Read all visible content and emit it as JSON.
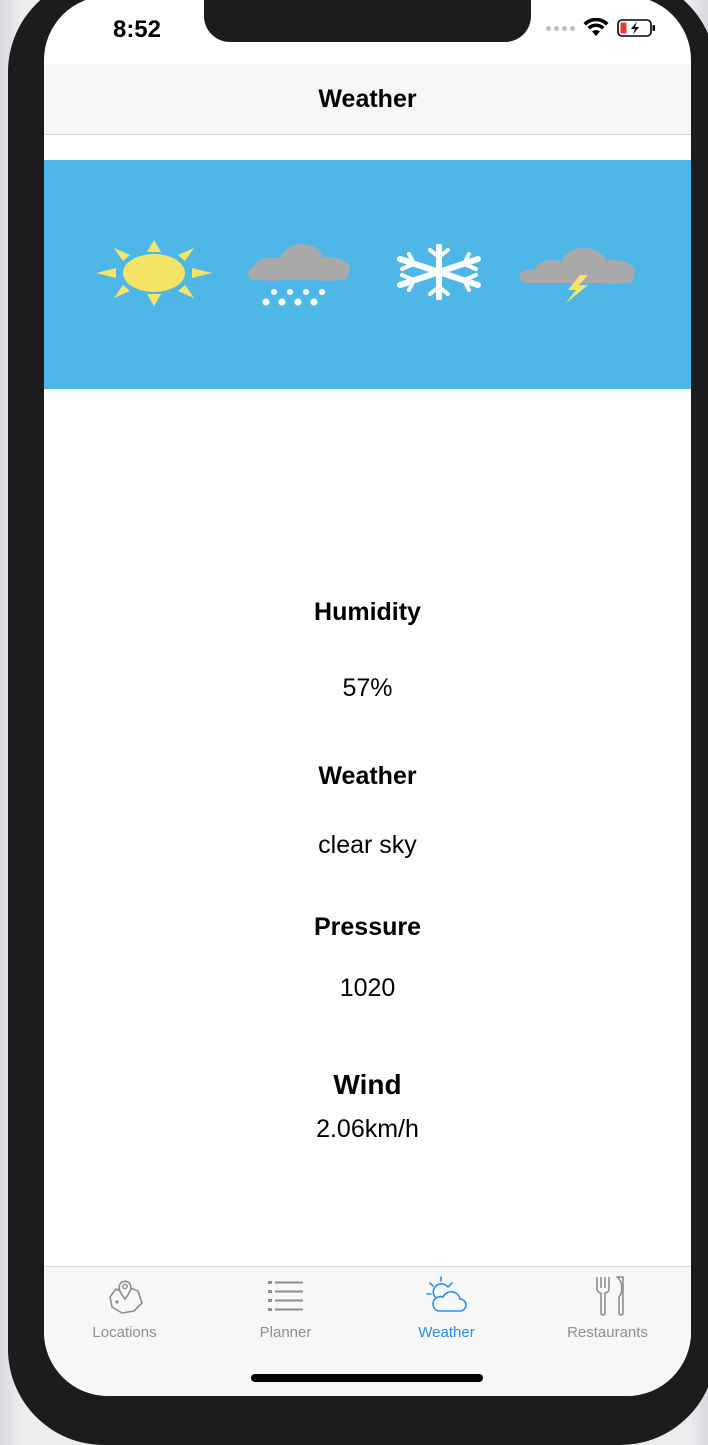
{
  "status_bar": {
    "time": "8:52",
    "wifi_icon": "wifi-icon",
    "battery_icon": "battery-charging-icon"
  },
  "nav": {
    "title": "Weather"
  },
  "banner": {
    "background": "#4fb7e8",
    "icons": [
      "sun-icon",
      "snow-cloud-icon",
      "snowflake-icon",
      "thunder-cloud-icon"
    ]
  },
  "details": {
    "humidity_label": "Humidity",
    "humidity_value": "57%",
    "weather_label": "Weather",
    "weather_value": "clear sky",
    "pressure_label": "Pressure",
    "pressure_value": "1020",
    "wind_label": "Wind",
    "wind_value": "2.06km/h"
  },
  "tabs": [
    {
      "label": "Locations",
      "icon": "map-pin-icon",
      "active": false
    },
    {
      "label": "Planner",
      "icon": "list-icon",
      "active": false
    },
    {
      "label": "Weather",
      "icon": "sun-cloud-icon",
      "active": true
    },
    {
      "label": "Restaurants",
      "icon": "fork-knife-icon",
      "active": false
    }
  ],
  "colors": {
    "accent": "#2b8de8",
    "tab_inactive": "#8e8e93",
    "sun": "#f6e467",
    "cloud": "#a9a9a9"
  }
}
